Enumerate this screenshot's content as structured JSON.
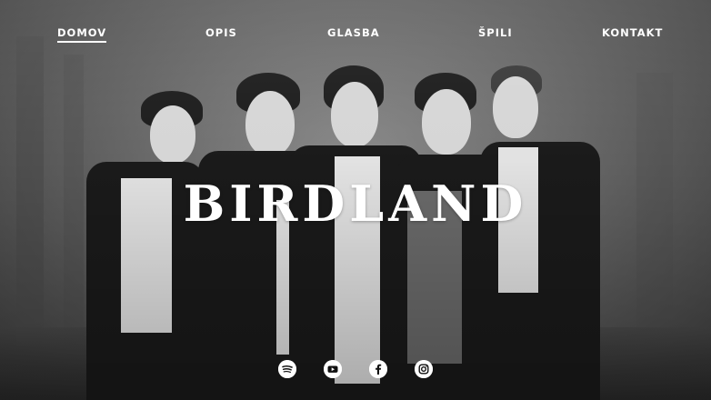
{
  "nav": {
    "items": [
      {
        "label": "DOMOV",
        "active": true
      },
      {
        "label": "OPIS",
        "active": false
      },
      {
        "label": "GLASBA",
        "active": false
      },
      {
        "label": "ŠPILI",
        "active": false
      },
      {
        "label": "KONTAKT",
        "active": false
      }
    ]
  },
  "hero": {
    "title": "BIRDLAND"
  },
  "socials": [
    {
      "icon": "spotify-icon"
    },
    {
      "icon": "youtube-icon"
    },
    {
      "icon": "facebook-icon"
    },
    {
      "icon": "instagram-icon"
    }
  ],
  "colors": {
    "text": "#ffffff",
    "background": "#6e6e6e"
  }
}
